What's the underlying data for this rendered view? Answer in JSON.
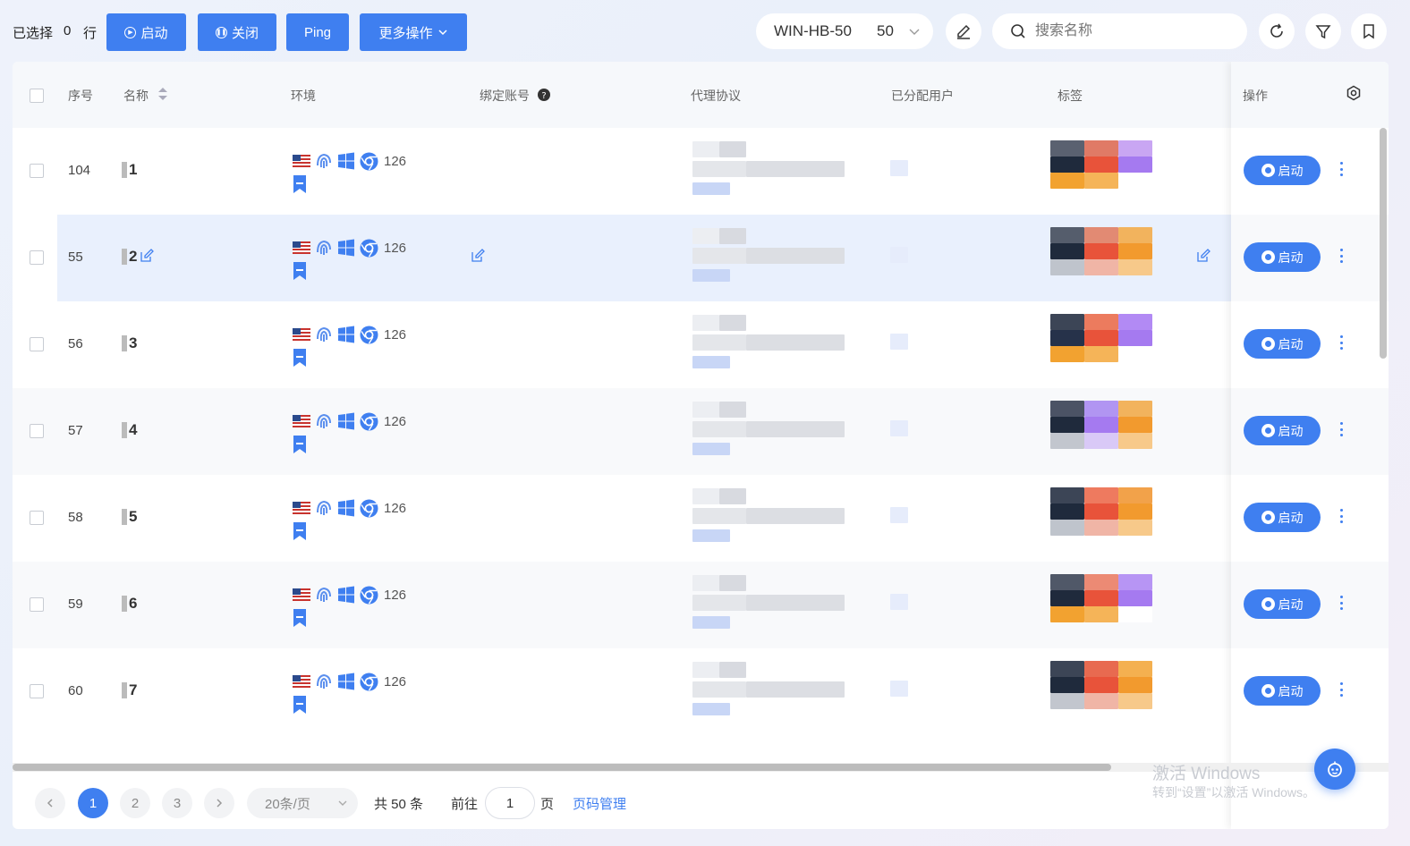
{
  "toolbar": {
    "selected_label": "已选择",
    "selected_count": "0",
    "selected_unit": "行",
    "start_label": "启动",
    "close_label": "关闭",
    "ping_label": "Ping",
    "more_label": "更多操作",
    "group_name": "WIN-HB-50",
    "group_count": "50",
    "search_placeholder": "搜索名称"
  },
  "table": {
    "headers": {
      "seq": "序号",
      "name": "名称",
      "env": "环境",
      "bound": "绑定账号",
      "proxy": "代理协议",
      "users": "已分配用户",
      "tags": "标签",
      "ops": "操作"
    },
    "rows": [
      {
        "seq": "104",
        "name": "1",
        "env_version": "126",
        "action": "启动"
      },
      {
        "seq": "55",
        "name": "2",
        "env_version": "126",
        "action": "启动"
      },
      {
        "seq": "56",
        "name": "3",
        "env_version": "126",
        "action": "启动"
      },
      {
        "seq": "57",
        "name": "4",
        "env_version": "126",
        "action": "启动"
      },
      {
        "seq": "58",
        "name": "5",
        "env_version": "126",
        "action": "启动"
      },
      {
        "seq": "59",
        "name": "6",
        "env_version": "126",
        "action": "启动"
      },
      {
        "seq": "60",
        "name": "7",
        "env_version": "126",
        "action": "启动"
      }
    ]
  },
  "pagination": {
    "pages": [
      "1",
      "2",
      "3"
    ],
    "current": "1",
    "page_size": "20条/页",
    "total": "共 50 条",
    "goto_label": "前往",
    "goto_value": "1",
    "page_unit": "页",
    "manage_label": "页码管理"
  },
  "watermark": {
    "line1": "激活 Windows",
    "line2": "转到“设置”以激活 Windows。"
  },
  "colors": {
    "accent": "#3f7ff0",
    "tag_dark": "#1f2a3c",
    "tag_red": "#e8533a",
    "tag_purple": "#a57af0",
    "tag_orange": "#f2a230"
  }
}
